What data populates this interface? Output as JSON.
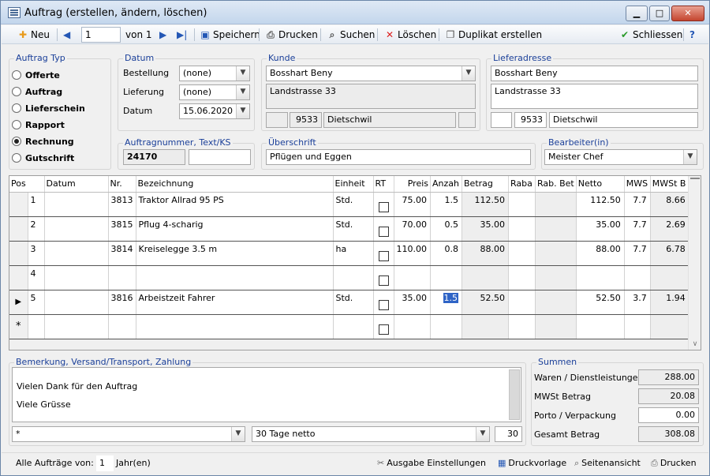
{
  "window": {
    "title": "Auftrag (erstellen, ändern, löschen)",
    "minimize": "▁",
    "maximize": "□",
    "close": "✕"
  },
  "toolbar": {
    "new_label": "Neu",
    "record_number": "1",
    "of_total": "von 1",
    "save_label": "Speichern",
    "print_label": "Drucken",
    "search_label": "Suchen",
    "delete_label": "Löschen",
    "duplicate_label": "Duplikat erstellen",
    "close_label": "Schliessen",
    "help_label": "?"
  },
  "order_type": {
    "title": "Auftrag Typ",
    "options": [
      "Offerte",
      "Auftrag",
      "Lieferschein",
      "Rapport",
      "Rechnung",
      "Gutschrift"
    ],
    "selected": "Rechnung"
  },
  "datum": {
    "title": "Datum",
    "bestellung_label": "Bestellung",
    "bestellung_value": "(none)",
    "lieferung_label": "Lieferung",
    "lieferung_value": "(none)",
    "datum_label": "Datum",
    "datum_value": "15.06.2020"
  },
  "kunde": {
    "title": "Kunde",
    "name": "Bosshart Beny",
    "street": "Landstrasse 33",
    "country": "",
    "zip": "9533",
    "city": "Dietschwil",
    "extra": ""
  },
  "lieferadresse": {
    "title": "Lieferadresse",
    "name": "Bosshart Beny",
    "street": "Landstrasse 33",
    "country": "",
    "zip": "9533",
    "city": "Dietschwil"
  },
  "auftragnummer": {
    "title": "Auftragnummer, Text/KS",
    "number": "24170",
    "text": ""
  },
  "ueberschrift": {
    "title": "Überschrift",
    "value": "Pflügen und Eggen"
  },
  "bearbeiter": {
    "title": "Bearbeiter(in)",
    "value": "Meister Chef"
  },
  "grid": {
    "columns": [
      "Pos",
      "Datum",
      "Nr.",
      "Bezeichnung",
      "Einheit",
      "RT",
      "Preis",
      "Anzah",
      "Betrag",
      "Raba",
      "Rab. Bet",
      "Netto",
      "MWS",
      "MWSt B"
    ],
    "rows": [
      {
        "pos": "1",
        "datum": "",
        "nr": "3813",
        "bezeichnung": "Traktor Allrad 95 PS",
        "einheit": "Std.",
        "preis": "75.00",
        "anzahl": "1.5",
        "betrag": "112.50",
        "raba": "",
        "rabbet": "",
        "netto": "112.50",
        "mws": "7.7",
        "mwstb": "8.66"
      },
      {
        "pos": "2",
        "datum": "",
        "nr": "3815",
        "bezeichnung": "Pflug 4-scharig",
        "einheit": "Std.",
        "preis": "70.00",
        "anzahl": "0.5",
        "betrag": "35.00",
        "raba": "",
        "rabbet": "",
        "netto": "35.00",
        "mws": "7.7",
        "mwstb": "2.69"
      },
      {
        "pos": "3",
        "datum": "",
        "nr": "3814",
        "bezeichnung": "Kreiselegge 3.5 m",
        "einheit": "ha",
        "preis": "110.00",
        "anzahl": "0.8",
        "betrag": "88.00",
        "raba": "",
        "rabbet": "",
        "netto": "88.00",
        "mws": "7.7",
        "mwstb": "6.78"
      },
      {
        "pos": "4",
        "datum": "",
        "nr": "",
        "bezeichnung": "",
        "einheit": "",
        "preis": "",
        "anzahl": "",
        "betrag": "",
        "raba": "",
        "rabbet": "",
        "netto": "",
        "mws": "",
        "mwstb": ""
      },
      {
        "pos": "5",
        "datum": "",
        "nr": "3816",
        "bezeichnung": "Arbeistzeit Fahrer",
        "einheit": "Std.",
        "preis": "35.00",
        "anzahl": "1.5",
        "betrag": "52.50",
        "raba": "",
        "rabbet": "",
        "netto": "52.50",
        "mws": "3.7",
        "mwstb": "1.94"
      },
      {
        "pos": "",
        "datum": "",
        "nr": "",
        "bezeichnung": "",
        "einheit": "",
        "preis": "",
        "anzahl": "",
        "betrag": "",
        "raba": "",
        "rabbet": "",
        "netto": "",
        "mws": "",
        "mwstb": ""
      }
    ],
    "current_row_marker": "▶",
    "new_row_marker": "*"
  },
  "bemerkung": {
    "title": "Bemerkung, Versand/Transport, Zahlung",
    "line1": "Vielen Dank für den Auftrag",
    "line2": "Viele Grüsse",
    "versand": "*",
    "zahlung": "30 Tage netto",
    "tage": "30"
  },
  "summen": {
    "title": "Summen",
    "waren_label": "Waren / Dienstleistungen",
    "waren_value": "288.00",
    "mwst_label": "MWSt Betrag",
    "mwst_value": "20.08",
    "porto_label": "Porto / Verpackung",
    "porto_value": "0.00",
    "gesamt_label": "Gesamt Betrag",
    "gesamt_value": "308.08"
  },
  "status": {
    "alle_label": "Alle Aufträge von:",
    "years_value": "1",
    "years_unit": "Jahr(en)",
    "ausgabe_label": "Ausgabe Einstellungen",
    "druckvorlage_label": "Druckvorlage",
    "seitenansicht_label": "Seitenansicht",
    "drucken_label": "Drucken"
  },
  "colors": {
    "accent": "#1a3f99",
    "selection": "#2f64c6",
    "close_button": "#c4452f",
    "add_icon": "#e89a1c",
    "delete_icon": "#d22",
    "ok_icon": "#2a9a2a"
  }
}
